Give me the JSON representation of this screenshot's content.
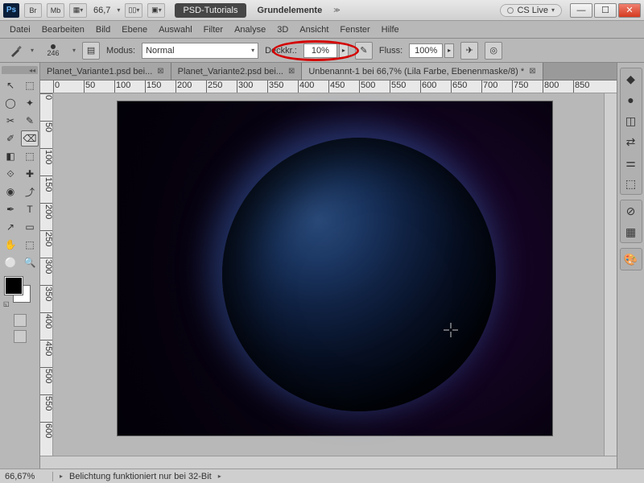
{
  "titlebar": {
    "zoom": "66,7",
    "workspace_primary": "PSD-Tutorials",
    "workspace_secondary": "Grundelemente",
    "cslive": "CS Live"
  },
  "menu": [
    "Datei",
    "Bearbeiten",
    "Bild",
    "Ebene",
    "Auswahl",
    "Filter",
    "Analyse",
    "3D",
    "Ansicht",
    "Fenster",
    "Hilfe"
  ],
  "options": {
    "brush_size": "246",
    "modus_label": "Modus:",
    "modus_value": "Normal",
    "opacity_label": "Deckkr.:",
    "opacity_value": "10%",
    "flow_label": "Fluss:",
    "flow_value": "100%"
  },
  "tabs": [
    {
      "label": "Planet_Variante1.psd bei...",
      "active": false
    },
    {
      "label": "Planet_Variante2.psd bei...",
      "active": false
    },
    {
      "label": "Unbenannt-1 bei 66,7% (Lila Farbe, Ebenenmaske/8) *",
      "active": true
    }
  ],
  "ruler_h": [
    "0",
    "50",
    "100",
    "150",
    "200",
    "250",
    "300",
    "350",
    "400",
    "450",
    "500",
    "550",
    "600",
    "650",
    "700",
    "750",
    "800",
    "850"
  ],
  "ruler_v": [
    "0",
    "50",
    "100",
    "150",
    "200",
    "250",
    "300",
    "350",
    "400",
    "450",
    "500",
    "550",
    "600"
  ],
  "status": {
    "zoom": "66,67%",
    "msg": "Belichtung funktioniert nur bei 32-Bit"
  },
  "tool_icons": [
    "↖",
    "⬚",
    "◯",
    "✦",
    "✂",
    "✎",
    "✐",
    "⌫",
    "◧",
    "⬚",
    "⟐",
    "✚",
    "◉",
    "⤴",
    "✒",
    "T",
    "↗",
    "▭",
    "✋",
    "⬚",
    "⚪",
    "🔍"
  ],
  "right_icons": [
    [
      "◆",
      "●",
      "◫",
      "⇄",
      "⚌",
      "⬚"
    ],
    [
      "⊘",
      "▦"
    ],
    [
      "🎨"
    ]
  ]
}
